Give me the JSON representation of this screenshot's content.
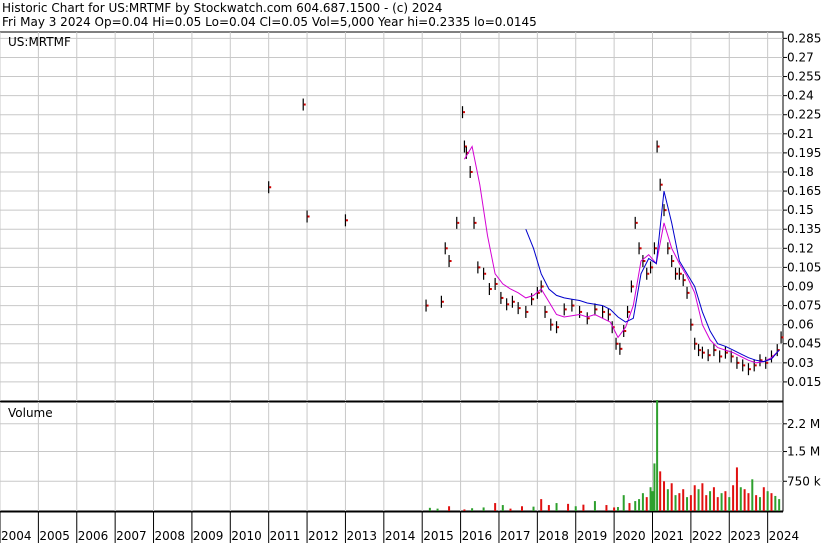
{
  "header": {
    "line1": "Historic Chart for US:MRTMF by Stockwatch.com 604.687.1500 - (c) 2024",
    "line2": "Fri May  3 2024   Op=0.04  Hi=0.05  Lo=0.04  Cl=0.05  Vol=5,000  Year hi=0.2335  lo=0.0145"
  },
  "chart_data": [
    {
      "type": "line",
      "title": "US:MRTMF",
      "xlabel": "",
      "ylabel": "",
      "ylim": [
        0.0,
        0.29
      ],
      "yticks": [
        "0.285",
        "0.27",
        "0.255",
        "0.24",
        "0.225",
        "0.21",
        "0.195",
        "0.18",
        "0.165",
        "0.15",
        "0.135",
        "0.12",
        "0.105",
        "0.09",
        "0.075",
        "0.06",
        "0.045",
        "0.03",
        "0.015"
      ],
      "ytick_values": [
        0.285,
        0.27,
        0.255,
        0.24,
        0.225,
        0.21,
        0.195,
        0.18,
        0.165,
        0.15,
        0.135,
        0.12,
        0.105,
        0.09,
        0.075,
        0.06,
        0.045,
        0.03,
        0.015
      ],
      "grid": true,
      "series": [
        {
          "kind": "price",
          "color": "#000000",
          "x": [
            2011.0,
            2011.9,
            2012.0,
            2013.0,
            2015.1,
            2015.5,
            2015.6,
            2015.7,
            2015.9,
            2016.05,
            2016.1,
            2016.15,
            2016.25,
            2016.35,
            2016.45,
            2016.6,
            2016.75,
            2016.9,
            2017.05,
            2017.2,
            2017.35,
            2017.5,
            2017.7,
            2017.85,
            2018.0,
            2018.1,
            2018.2,
            2018.35,
            2018.5,
            2018.7,
            2018.9,
            2019.1,
            2019.3,
            2019.5,
            2019.7,
            2019.85,
            2019.95,
            2020.05,
            2020.15,
            2020.25,
            2020.35,
            2020.45,
            2020.55,
            2020.65,
            2020.75,
            2020.85,
            2020.95,
            2021.05,
            2021.12,
            2021.2,
            2021.3,
            2021.4,
            2021.5,
            2021.6,
            2021.7,
            2021.8,
            2021.9,
            2022.0,
            2022.1,
            2022.2,
            2022.3,
            2022.45,
            2022.6,
            2022.75,
            2022.9,
            2023.05,
            2023.2,
            2023.35,
            2023.5,
            2023.65,
            2023.8,
            2023.95,
            2024.1,
            2024.25,
            2024.35
          ],
          "y": [
            0.168,
            0.233,
            0.145,
            0.142,
            0.075,
            0.078,
            0.12,
            0.11,
            0.14,
            0.227,
            0.2,
            0.195,
            0.18,
            0.14,
            0.105,
            0.1,
            0.088,
            0.092,
            0.081,
            0.076,
            0.078,
            0.073,
            0.07,
            0.08,
            0.085,
            0.09,
            0.07,
            0.06,
            0.058,
            0.072,
            0.075,
            0.07,
            0.065,
            0.072,
            0.07,
            0.068,
            0.058,
            0.045,
            0.041,
            0.055,
            0.07,
            0.09,
            0.14,
            0.12,
            0.11,
            0.1,
            0.105,
            0.12,
            0.2,
            0.17,
            0.15,
            0.12,
            0.11,
            0.1,
            0.1,
            0.095,
            0.085,
            0.06,
            0.045,
            0.04,
            0.038,
            0.036,
            0.04,
            0.035,
            0.038,
            0.035,
            0.03,
            0.028,
            0.025,
            0.028,
            0.032,
            0.03,
            0.035,
            0.04,
            0.05
          ]
        },
        {
          "kind": "moving-average",
          "color": "#d400d4",
          "x": [
            2016.1,
            2016.3,
            2016.5,
            2016.7,
            2016.9,
            2017.1,
            2017.3,
            2017.5,
            2017.7,
            2017.9,
            2018.1,
            2018.3,
            2018.5,
            2018.7,
            2018.9,
            2019.1,
            2019.3,
            2019.5,
            2019.7,
            2019.9,
            2020.1,
            2020.3,
            2020.5,
            2020.7,
            2020.9,
            2021.1,
            2021.3,
            2021.5,
            2021.7,
            2021.9,
            2022.1,
            2022.3,
            2022.5,
            2022.7,
            2022.9,
            2023.1,
            2023.3,
            2023.5,
            2023.7,
            2023.9,
            2024.1,
            2024.3
          ],
          "y": [
            0.19,
            0.2,
            0.17,
            0.13,
            0.1,
            0.092,
            0.088,
            0.085,
            0.081,
            0.083,
            0.088,
            0.078,
            0.068,
            0.066,
            0.067,
            0.068,
            0.066,
            0.068,
            0.065,
            0.062,
            0.05,
            0.058,
            0.075,
            0.11,
            0.115,
            0.108,
            0.14,
            0.12,
            0.108,
            0.098,
            0.085,
            0.06,
            0.048,
            0.042,
            0.04,
            0.038,
            0.035,
            0.032,
            0.03,
            0.031,
            0.034,
            0.04
          ]
        },
        {
          "kind": "moving-average",
          "color": "#0000cc",
          "x": [
            2017.7,
            2017.9,
            2018.1,
            2018.3,
            2018.5,
            2018.7,
            2018.9,
            2019.1,
            2019.3,
            2019.5,
            2019.7,
            2019.9,
            2020.1,
            2020.3,
            2020.5,
            2020.7,
            2020.9,
            2021.1,
            2021.3,
            2021.5,
            2021.7,
            2021.9,
            2022.1,
            2022.3,
            2022.5,
            2022.7,
            2022.9,
            2023.1,
            2023.3,
            2023.5,
            2023.7,
            2023.9,
            2024.1,
            2024.3
          ],
          "y": [
            0.135,
            0.12,
            0.1,
            0.088,
            0.083,
            0.081,
            0.08,
            0.079,
            0.077,
            0.076,
            0.075,
            0.072,
            0.066,
            0.062,
            0.065,
            0.1,
            0.112,
            0.108,
            0.165,
            0.14,
            0.11,
            0.1,
            0.09,
            0.07,
            0.055,
            0.045,
            0.043,
            0.04,
            0.037,
            0.034,
            0.032,
            0.031,
            0.033,
            0.04
          ]
        }
      ]
    },
    {
      "type": "bar",
      "title": "Volume",
      "yticks": [
        "2.2 M",
        "1.5 M",
        "750 k"
      ],
      "ytick_values": [
        2200000,
        1500000,
        750000
      ],
      "ylim": [
        0,
        2750000
      ],
      "series": [
        {
          "name": "",
          "up_color": "#2ea02e",
          "down_color": "#e01010",
          "x": [
            2015.2,
            2015.4,
            2015.7,
            2016.1,
            2016.3,
            2016.6,
            2016.9,
            2017.1,
            2017.3,
            2017.6,
            2017.9,
            2018.1,
            2018.3,
            2018.5,
            2018.8,
            2019.0,
            2019.2,
            2019.5,
            2019.8,
            2020.0,
            2020.1,
            2020.25,
            2020.4,
            2020.55,
            2020.65,
            2020.75,
            2020.85,
            2020.95,
            2021.0,
            2021.05,
            2021.12,
            2021.2,
            2021.3,
            2021.4,
            2021.5,
            2021.6,
            2021.7,
            2021.8,
            2021.9,
            2022.0,
            2022.1,
            2022.2,
            2022.3,
            2022.4,
            2022.5,
            2022.6,
            2022.7,
            2022.8,
            2022.9,
            2023.0,
            2023.1,
            2023.2,
            2023.3,
            2023.4,
            2023.5,
            2023.6,
            2023.7,
            2023.8,
            2023.9,
            2024.0,
            2024.1,
            2024.2,
            2024.3
          ],
          "values": [
            80000,
            60000,
            120000,
            40000,
            70000,
            90000,
            200000,
            150000,
            60000,
            120000,
            110000,
            300000,
            150000,
            200000,
            180000,
            120000,
            160000,
            250000,
            150000,
            90000,
            100000,
            400000,
            200000,
            250000,
            300000,
            450000,
            350000,
            600000,
            500000,
            1200000,
            2800000,
            1000000,
            750000,
            550000,
            700000,
            400000,
            450000,
            550000,
            350000,
            400000,
            650000,
            550000,
            700000,
            400000,
            500000,
            600000,
            350000,
            450000,
            500000,
            350000,
            650000,
            1100000,
            600000,
            550000,
            450000,
            800000,
            400000,
            350000,
            600000,
            500000,
            450000,
            380000,
            300000
          ],
          "up": [
            true,
            true,
            false,
            false,
            true,
            true,
            false,
            true,
            false,
            false,
            true,
            false,
            false,
            true,
            false,
            true,
            false,
            true,
            false,
            false,
            true,
            true,
            false,
            true,
            true,
            true,
            false,
            true,
            true,
            true,
            true,
            false,
            false,
            true,
            false,
            true,
            false,
            false,
            true,
            false,
            false,
            true,
            false,
            false,
            true,
            false,
            false,
            true,
            false,
            true,
            false,
            false,
            true,
            false,
            false,
            true,
            false,
            true,
            false,
            true,
            false,
            true,
            true
          ]
        }
      ]
    }
  ],
  "xaxis": {
    "labels": [
      "2004",
      "2005",
      "2006",
      "2007",
      "2008",
      "2009",
      "2010",
      "2011",
      "2012",
      "2013",
      "2014",
      "2015",
      "2016",
      "2017",
      "2018",
      "2019",
      "2020",
      "2021",
      "2022",
      "2023",
      "2024"
    ],
    "range": [
      2004.0,
      2024.4
    ]
  },
  "panels": {
    "price_label": "US:MRTMF",
    "volume_label": "Volume"
  }
}
